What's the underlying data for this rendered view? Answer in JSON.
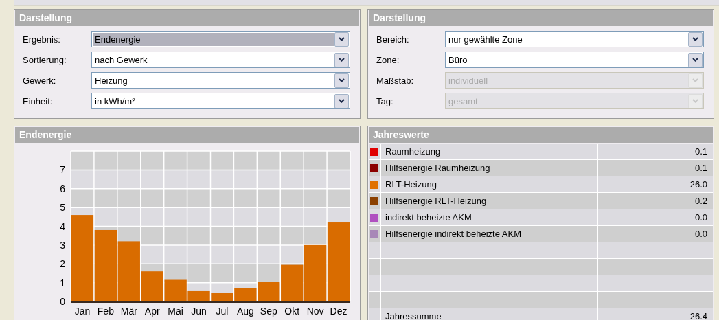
{
  "panels_top": [
    {
      "title": "Darstellung",
      "fields": [
        {
          "label": "Ergebnis:",
          "value": "Endenergie",
          "disabled": false,
          "focused": true
        },
        {
          "label": "Sortierung:",
          "value": "nach Gewerk",
          "disabled": false,
          "focused": false
        },
        {
          "label": "Gewerk:",
          "value": "Heizung",
          "disabled": false,
          "focused": false
        },
        {
          "label": "Einheit:",
          "value": "in kWh/m²",
          "disabled": false,
          "focused": false
        }
      ]
    },
    {
      "title": "Darstellung",
      "fields": [
        {
          "label": "Bereich:",
          "value": "nur gewählte Zone",
          "disabled": false,
          "focused": false
        },
        {
          "label": "Zone:",
          "value": "Büro",
          "disabled": false,
          "focused": false
        },
        {
          "label": "Maßstab:",
          "value": "individuell",
          "disabled": true,
          "focused": false
        },
        {
          "label": "Tag:",
          "value": "gesamt",
          "disabled": true,
          "focused": false
        }
      ]
    }
  ],
  "chart_panel": {
    "title": "Endenergie",
    "chart_data": {
      "type": "bar",
      "categories": [
        "Jan",
        "Feb",
        "Mär",
        "Apr",
        "Mai",
        "Jun",
        "Jul",
        "Aug",
        "Sep",
        "Okt",
        "Nov",
        "Dez"
      ],
      "grid": true,
      "series": [
        {
          "color": "#d96c00",
          "values": [
            4.6,
            3.8,
            3.2,
            1.6,
            1.15,
            0.55,
            0.45,
            0.7,
            1.05,
            1.95,
            3.0,
            4.2
          ]
        }
      ],
      "ylim": [
        0,
        8
      ],
      "yticks": [
        0,
        1,
        2,
        3,
        4,
        5,
        6,
        7
      ]
    }
  },
  "table_panel": {
    "title": "Jahreswerte",
    "rows": [
      {
        "name": "Raumheizung",
        "value": "0.1",
        "color": "#e00000"
      },
      {
        "name": "Hilfsenergie Raumheizung",
        "value": "0.1",
        "color": "#8b0000"
      },
      {
        "name": "RLT-Heizung",
        "value": "26.0",
        "color": "#e07000"
      },
      {
        "name": "Hilfsenergie RLT-Heizung",
        "value": "0.2",
        "color": "#8b4000"
      },
      {
        "name": "indirekt beheizte AKM",
        "value": "0.0",
        "color": "#b050c0"
      },
      {
        "name": "Hilfsenergie indirekt beheizte AKM",
        "value": "0.0",
        "color": "#a888b8"
      }
    ],
    "total": {
      "name": "Jahressumme",
      "value": "26.4"
    }
  }
}
